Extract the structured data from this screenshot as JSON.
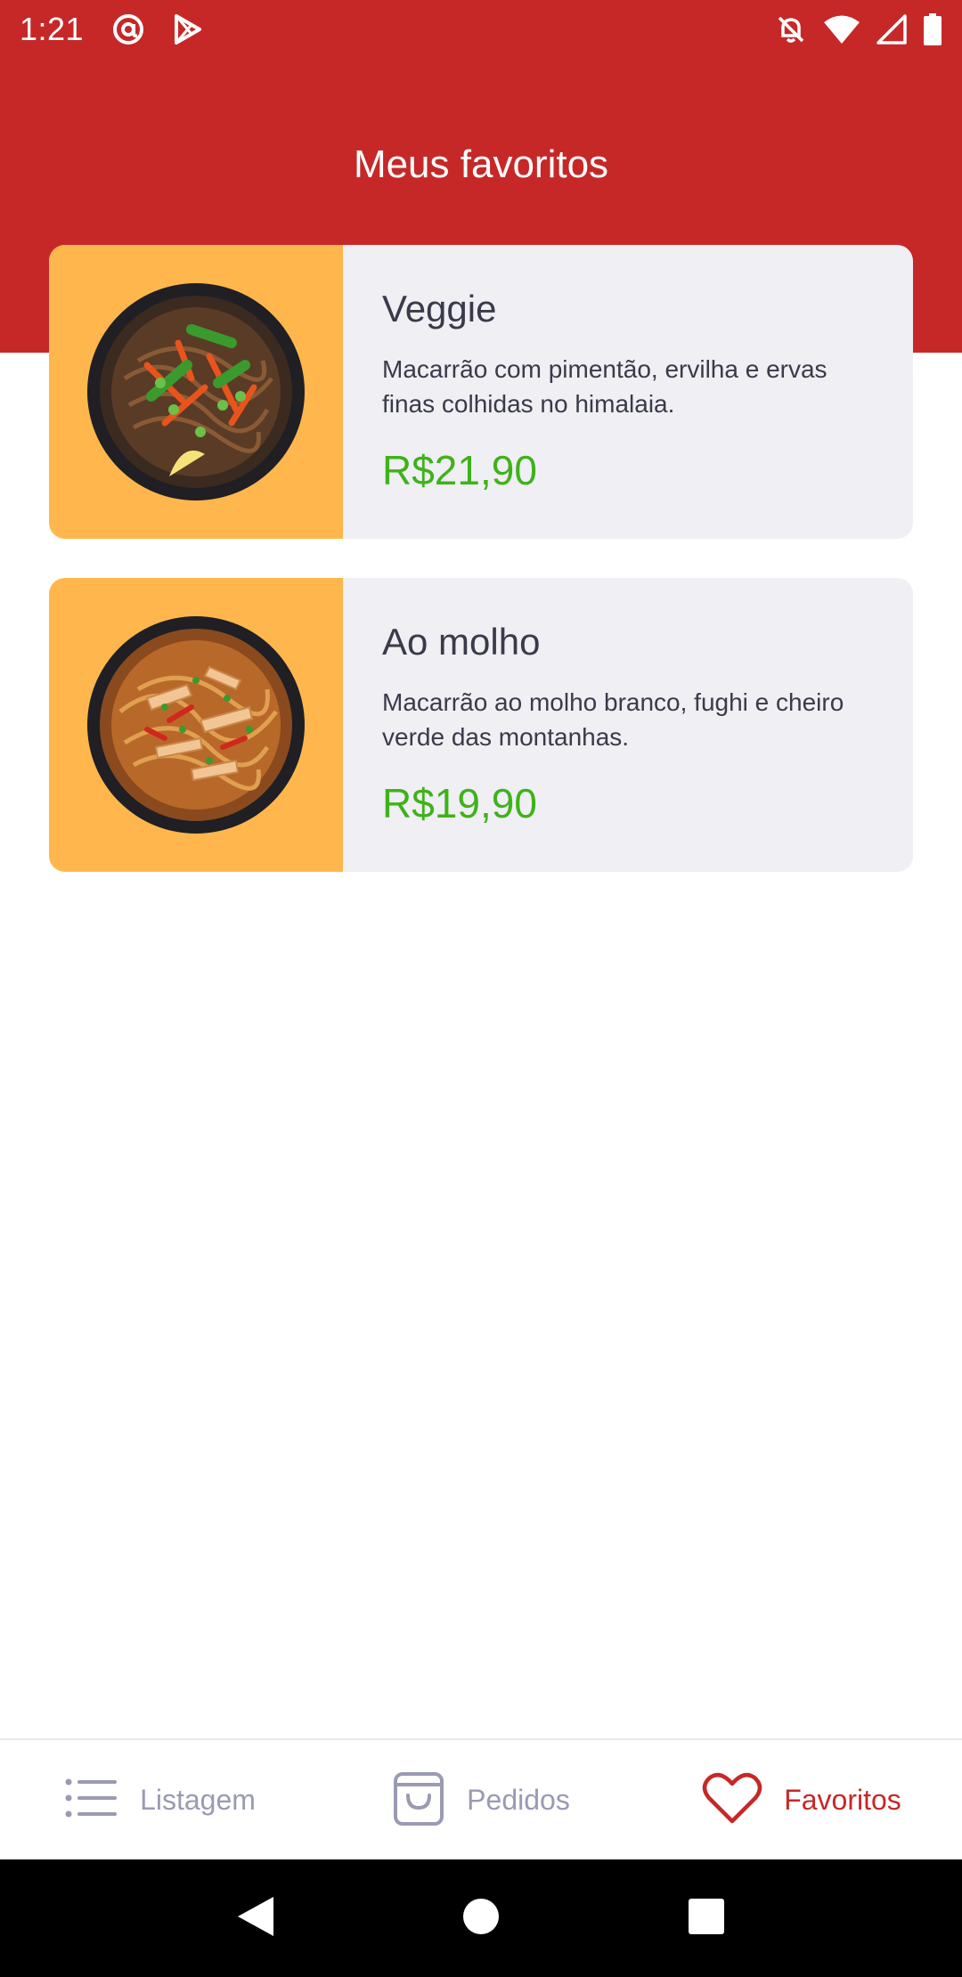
{
  "status_bar": {
    "time": "1:21"
  },
  "header": {
    "title": "Meus favoritos"
  },
  "favorites": [
    {
      "title": "Veggie",
      "description": "Macarrão com pimentão, ervilha e ervas finas colhidas no himalaia.",
      "price": "R$21,90",
      "image_icon": "noodle-bowl-veggie-image"
    },
    {
      "title": "Ao molho",
      "description": "Macarrão ao molho branco, fughi e cheiro verde das montanhas.",
      "price": "R$19,90",
      "image_icon": "noodle-bowl-sauce-image"
    }
  ],
  "bottom_nav": {
    "items": [
      {
        "label": "Listagem",
        "icon": "list-icon",
        "active": false
      },
      {
        "label": "Pedidos",
        "icon": "shopping-bag-icon",
        "active": false
      },
      {
        "label": "Favoritos",
        "icon": "heart-icon",
        "active": true
      }
    ]
  },
  "colors": {
    "brand_red": "#c62828",
    "card_background": "#efeff4",
    "image_background": "#ffb74d",
    "price_green": "#3fb21a",
    "inactive_nav": "#9a9ab4"
  }
}
